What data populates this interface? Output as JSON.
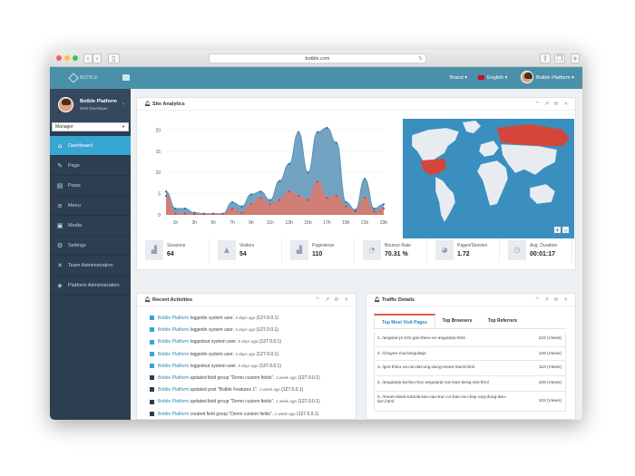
{
  "browser": {
    "url": "botble.com"
  },
  "topnav": {
    "logo": "BOTBLE",
    "brand": "Brand",
    "language": "English",
    "user": "Botble Platform"
  },
  "profile": {
    "name": "Botble Platform",
    "role": "Web Developer",
    "select": "Manager"
  },
  "sidebar": {
    "items": [
      {
        "label": "Dashboard",
        "icon": "⌂"
      },
      {
        "label": "Page",
        "icon": "✎"
      },
      {
        "label": "Posts",
        "icon": "▤"
      },
      {
        "label": "Menu",
        "icon": "≡"
      },
      {
        "label": "Media",
        "icon": "▣"
      },
      {
        "label": "Settings",
        "icon": "⚙"
      },
      {
        "label": "Team Administration",
        "icon": "✕"
      },
      {
        "label": "Platform Administration",
        "icon": "◈"
      }
    ]
  },
  "analytics": {
    "title": "Site Analytics",
    "tools": "^ ↗ ⟳ ✕",
    "stats": [
      {
        "label": "Sessions",
        "value": "64",
        "icon": "▟"
      },
      {
        "label": "Visitors",
        "value": "54",
        "icon": "▲"
      },
      {
        "label": "Pageviews",
        "value": "110",
        "icon": "▟"
      },
      {
        "label": "Bounce Rate",
        "value": "70.31 %",
        "icon": "◔"
      },
      {
        "label": "Pages/Session",
        "value": "1.72",
        "icon": "◕"
      },
      {
        "label": "Avg. Duration",
        "value": "00:01:17",
        "icon": "◷"
      }
    ]
  },
  "chart_data": {
    "type": "area",
    "x": [
      "0h",
      "1h",
      "2h",
      "3h",
      "4h",
      "5h",
      "6h",
      "7h",
      "8h",
      "9h",
      "10h",
      "11h",
      "12h",
      "13h",
      "14h",
      "15h",
      "16h",
      "17h",
      "18h",
      "19h",
      "20h",
      "21h",
      "22h",
      "23h"
    ],
    "xticks": [
      "1h",
      "3h",
      "5h",
      "7h",
      "9h",
      "11h",
      "13h",
      "15h",
      "17h",
      "19h",
      "21h",
      "23h"
    ],
    "yticks": [
      "0",
      "5",
      "10",
      "15",
      "20"
    ],
    "ylim": [
      0,
      22
    ],
    "series": [
      {
        "values": [
          5.5,
          1.5,
          1.5,
          0.5,
          0.3,
          0.3,
          0.3,
          3,
          2,
          4.8,
          5.5,
          3.5,
          8,
          12,
          19.5,
          10,
          19.5,
          20.5,
          17,
          3,
          1.2,
          8.5,
          1.5,
          2.5
        ],
        "color": "#5b93b8"
      },
      {
        "values": [
          4.5,
          0.3,
          0.3,
          0.2,
          0.2,
          0.2,
          0.2,
          1.5,
          0.5,
          2.5,
          4,
          2.5,
          3.5,
          5.5,
          4.5,
          3.5,
          7.8,
          4,
          4.5,
          2,
          0.8,
          4,
          0.8,
          1.5
        ],
        "color": "#e07868"
      }
    ]
  },
  "activities": {
    "title": "Recent Activities",
    "tools": "^ ↗ ⟳ ✕",
    "items": [
      {
        "user": "Botble Platform",
        "text": "loggedin system user.",
        "time": "5 days ago",
        "ip": "(127.0.0.1)",
        "color": "#37a6d2"
      },
      {
        "user": "Botble Platform",
        "text": "loggedin system user.",
        "time": "5 days ago",
        "ip": "(127.0.0.1)",
        "color": "#37a6d2"
      },
      {
        "user": "Botble Platform",
        "text": "loggedout system user.",
        "time": "5 days ago",
        "ip": "(127.0.0.1)",
        "color": "#37a6d2"
      },
      {
        "user": "Botble Platform",
        "text": "loggedin system user.",
        "time": "5 days ago",
        "ip": "(127.0.0.1)",
        "color": "#37a6d2"
      },
      {
        "user": "Botble Platform",
        "text": "loggedout system user.",
        "time": "5 days ago",
        "ip": "(127.0.0.1)",
        "color": "#37a6d2"
      },
      {
        "user": "Botble Platform",
        "text": "updated field group \"Demo custom fields\".",
        "time": "1 week ago",
        "ip": "(127.0.0.1)",
        "color": "#2c3e50"
      },
      {
        "user": "Botble Platform",
        "text": "updated post \"Botble Features 1\".",
        "time": "1 week ago",
        "ip": "(127.0.0.1)",
        "color": "#2c3e50"
      },
      {
        "user": "Botble Platform",
        "text": "updated field group \"Demo custom fields\".",
        "time": "1 week ago",
        "ip": "(127.0.0.1)",
        "color": "#2c3e50"
      },
      {
        "user": "Botble Platform",
        "text": "created field group \"Demo custom fields\".",
        "time": "1 week ago",
        "ip": "(127.0.0.1)",
        "color": "#2c3e50"
      }
    ]
  },
  "traffic": {
    "title": "Traffic Details",
    "tools": "^ ↗ ⟳ ✕",
    "tabs": [
      "Top Most Visit Pages",
      "Top Browsers",
      "Top Referrers"
    ],
    "rows": [
      {
        "page": "1. /angular-js-101-gioi-thieu-ve-angularjs.html",
        "views": "222 (Views)"
      },
      {
        "page": "2. /chuyen-muc/angularjs",
        "views": "129 (Views)"
      },
      {
        "page": "3. /gioi-thieu-va-cai-dat-ung-dung-mean-stack.html",
        "views": "110 (Views)"
      },
      {
        "page": "4. /angularjs-tai-lieu-hoc-angularjs-can-ban-tieng-viet.html",
        "views": "109 (Views)"
      },
      {
        "page": "5. /mean-stack-tutorial-tao-cau-truc-co-ban-va-chay-ung-dung-dau-tien.html",
        "views": "102 (Views)"
      }
    ]
  },
  "map": {
    "zoom_in": "+",
    "zoom_out": "−"
  }
}
